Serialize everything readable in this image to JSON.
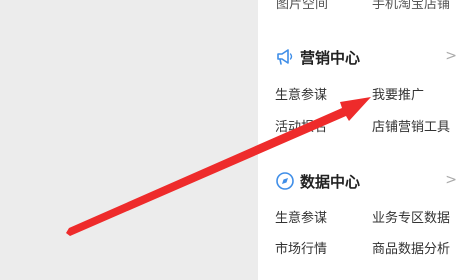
{
  "top_cut": {
    "left_text": "图片空间",
    "right_text": "手机淘宝店铺"
  },
  "marketing": {
    "title": "营销中心",
    "chevron": ">",
    "icon": "megaphone-icon",
    "items": [
      "生意参谋",
      "我要推广",
      "活动报名",
      "店铺营销工具"
    ]
  },
  "data_center": {
    "title": "数据中心",
    "chevron": ">",
    "icon": "compass-icon",
    "items": [
      "生意参谋",
      "业务专区数据",
      "市场行情",
      "商品数据分析"
    ]
  },
  "colors": {
    "accent_blue": "#3f8ee8",
    "arrow_red": "#ee2b2b",
    "panel_bg": "#ffffff",
    "page_bg": "#ececec"
  }
}
